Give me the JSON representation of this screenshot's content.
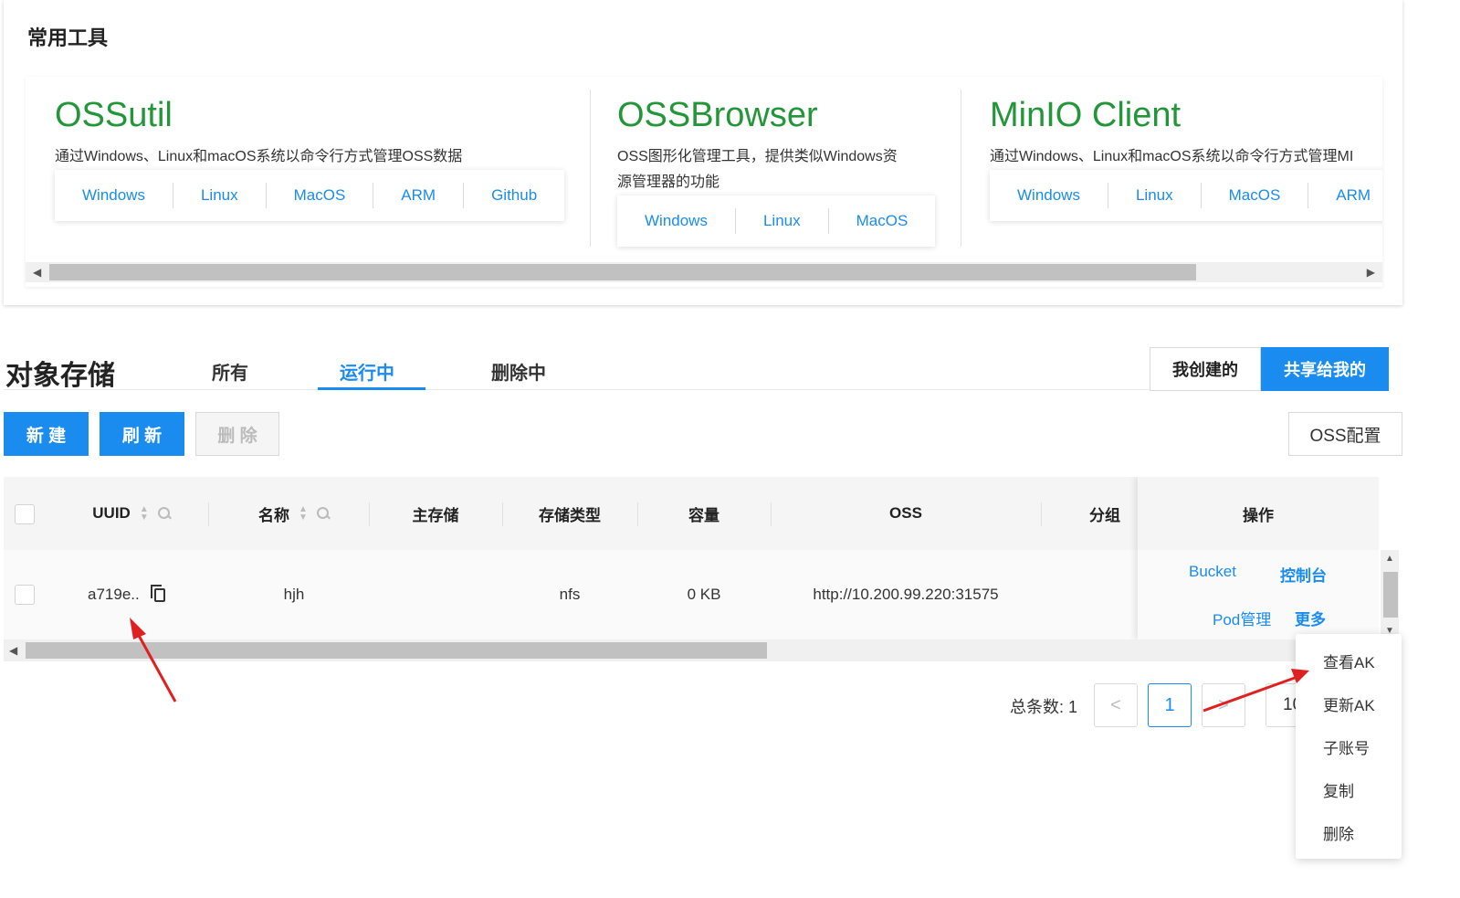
{
  "tools": {
    "title": "常用工具",
    "items": [
      {
        "name": "OSSutil",
        "desc_lines": [
          "通过Windows、Linux和macOS系统以命令行方式管理OSS数据"
        ],
        "links": [
          "Windows",
          "Linux",
          "MacOS",
          "ARM",
          "Github"
        ]
      },
      {
        "name": "OSSBrowser",
        "desc_lines": [
          "OSS图形化管理工具，提供类似Windows资",
          "源管理器的功能"
        ],
        "links": [
          "Windows",
          "Linux",
          "MacOS"
        ]
      },
      {
        "name": "MinIO Client",
        "desc_lines": [
          "通过Windows、Linux和macOS系统以命令行方式管理MI"
        ],
        "links": [
          "Windows",
          "Linux",
          "MacOS",
          "ARM"
        ]
      }
    ]
  },
  "storage": {
    "title": "对象存储",
    "tabs": [
      "所有",
      "运行中",
      "删除中"
    ],
    "active_tab": "运行中",
    "ownership": [
      "我创建的",
      "共享给我的"
    ],
    "ownership_active": "共享给我的",
    "buttons": {
      "create": "新 建",
      "refresh": "刷 新",
      "delete": "删 除",
      "oss_config": "OSS配置"
    }
  },
  "table": {
    "columns": [
      "UUID",
      "名称",
      "主存储",
      "存储类型",
      "容量",
      "OSS",
      "分组",
      "操作"
    ],
    "rows": [
      {
        "uuid": "a719e..",
        "name": "hjh",
        "primary": "",
        "type": "nfs",
        "capacity": "0 KB",
        "oss": "http://10.200.99.220:31575",
        "group": ""
      }
    ],
    "actions": {
      "bucket": "Bucket",
      "console": "控制台",
      "pod": "Pod管理",
      "more": "更多"
    }
  },
  "pagination": {
    "total_label": "总条数: 1",
    "current_page": "1",
    "page_size": "10",
    "prev": "<",
    "next": ">"
  },
  "more_menu": [
    "查看AK",
    "更新AK",
    "子账号",
    "复制",
    "删除"
  ],
  "colors": {
    "accent": "#1a8cf0",
    "tool_name": "#23963a",
    "annotation": "#e02020"
  }
}
